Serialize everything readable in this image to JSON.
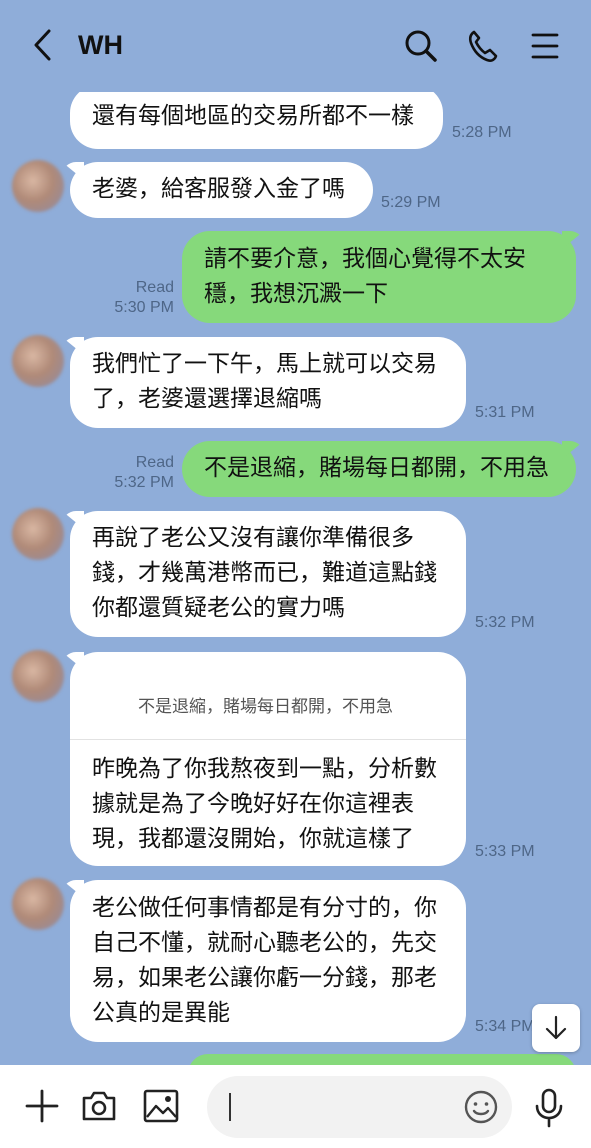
{
  "header": {
    "title": "WH",
    "icons": [
      "back-chevron-icon",
      "search-icon",
      "phone-icon",
      "menu-icon"
    ]
  },
  "messages": [
    {
      "side": "in",
      "lines": [
        "還有每個地區的交易所都不一樣"
      ],
      "time": "5:28 PM"
    },
    {
      "side": "in",
      "lines": [
        "老婆，給客服發入金了嗎"
      ],
      "time": "5:29 PM"
    },
    {
      "side": "out",
      "lines": [
        "請不要介意，我個心覺得不太安",
        "穩，我想沉澱一下"
      ],
      "read": "Read",
      "time": "5:30 PM"
    },
    {
      "side": "in",
      "lines": [
        "我們忙了一下午，馬上就可以交易",
        "了，老婆還選擇退縮嗎"
      ],
      "time": "5:31 PM"
    },
    {
      "side": "out",
      "lines": [
        "不是退縮，賭場每日都開，不用急"
      ],
      "read": "Read",
      "time": "5:32 PM"
    },
    {
      "side": "in",
      "lines": [
        "再說了老公又沒有讓你準備很多",
        "錢，才幾萬港幣而已，難道這點錢",
        "你都還質疑老公的實力嗎"
      ],
      "time": "5:32 PM"
    },
    {
      "side": "in",
      "quote": "不是退縮，賭場每日都開，不用急",
      "lines": [
        "昨晚為了你我熬夜到一點，分析數",
        "據就是為了今晚好好在你這裡表",
        "現，我都還沒開始，你就這樣了"
      ],
      "time": "5:33 PM"
    },
    {
      "side": "in",
      "lines": [
        "老公做任何事情都是有分寸的，你",
        "自己不懂，就耐心聽老公的，先交",
        "易，如果老公讓你虧一分錢，那老",
        "公真的是異能"
      ],
      "time": "5:34 PM"
    }
  ],
  "composer": {
    "placeholder": "",
    "icons": [
      "plus-icon",
      "camera-icon",
      "image-icon",
      "emoji-icon",
      "microphone-icon"
    ]
  },
  "scroll_button": {
    "icon": "arrow-down-icon"
  }
}
